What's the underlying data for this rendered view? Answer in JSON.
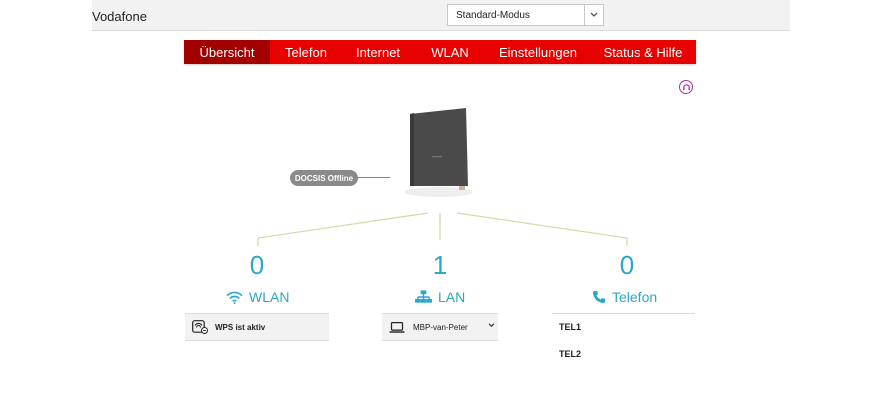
{
  "header": {
    "brand": "Vodafone",
    "mode": "Standard-Modus"
  },
  "nav": [
    {
      "label": "Übersicht",
      "active": true
    },
    {
      "label": "Telefon",
      "active": false
    },
    {
      "label": "Internet",
      "active": false
    },
    {
      "label": "WLAN",
      "active": false
    },
    {
      "label": "Einstellungen",
      "active": false
    },
    {
      "label": "Status & Hilfe",
      "active": false
    }
  ],
  "device": {
    "status": "DOCSIS Offline"
  },
  "sections": {
    "wlan": {
      "count": "0",
      "label": "WLAN",
      "items": [
        "WPS ist aktiv"
      ]
    },
    "lan": {
      "count": "1",
      "label": "LAN",
      "items": [
        "MBP-van-Peter"
      ]
    },
    "telefon": {
      "count": "0",
      "label": "Telefon",
      "items": [
        "TEL1",
        "TEL2"
      ]
    }
  },
  "colors": {
    "brand_red": "#e60000",
    "active_tab": "#a30000",
    "accent": "#2aa8c8",
    "help": "#b0309a"
  }
}
